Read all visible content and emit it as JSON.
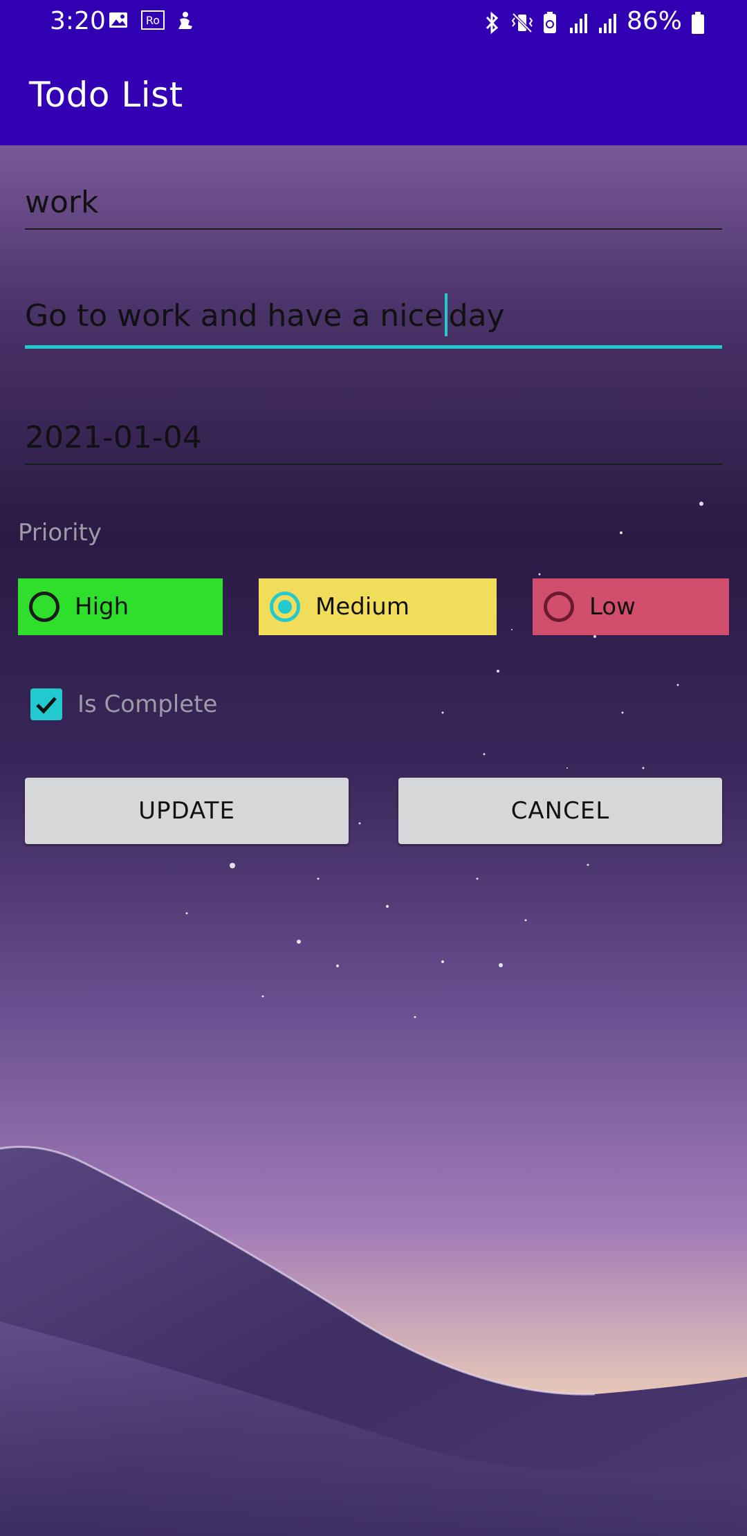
{
  "status_bar": {
    "time": "3:20",
    "battery": "86%",
    "left_icons": [
      "image-icon",
      "ro-icon",
      "notification-icon"
    ],
    "right_icons": [
      "bluetooth-icon",
      "vibrate-icon",
      "battery-saver-icon",
      "signal-icon",
      "signal-icon-2",
      "battery-icon"
    ]
  },
  "app_bar": {
    "title": "Todo List",
    "color": "#3300b3"
  },
  "form": {
    "title_value": "work",
    "description_value_before_caret": "Go to work and have a nice",
    "description_value_after_caret": "day",
    "date_value": "2021-01-04",
    "priority_label": "Priority",
    "priorities": [
      {
        "label": "High",
        "color": "#2ee02c",
        "selected": false
      },
      {
        "label": "Medium",
        "color": "#f1dd5a",
        "selected": true
      },
      {
        "label": "Low",
        "color": "#d14f6c",
        "selected": false
      }
    ],
    "is_complete_label": "Is Complete",
    "is_complete": true,
    "update_label": "UPDATE",
    "cancel_label": "CANCEL"
  },
  "colors": {
    "accent": "#22c9cf",
    "status_bar": "#3100b2"
  }
}
